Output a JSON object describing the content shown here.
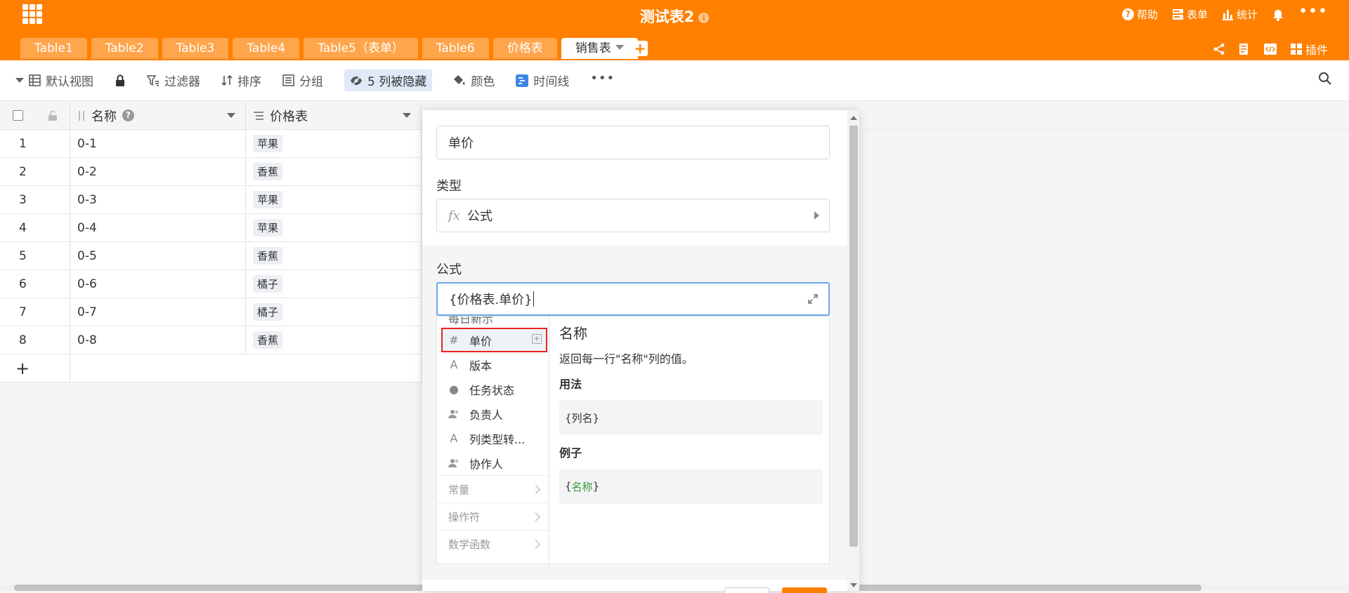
{
  "header": {
    "title": "测试表2",
    "actions": {
      "help": "帮助",
      "form": "表单",
      "stats": "统计"
    }
  },
  "tabs": [
    {
      "label": "Table1"
    },
    {
      "label": "Table2"
    },
    {
      "label": "Table3"
    },
    {
      "label": "Table4"
    },
    {
      "label": "Table5（表单）"
    },
    {
      "label": "Table6"
    },
    {
      "label": "价格表"
    },
    {
      "label": "销售表",
      "active": true
    }
  ],
  "tab_right": {
    "plugins": "插件"
  },
  "toolbar": {
    "view": "默认视图",
    "filter": "过滤器",
    "sort": "排序",
    "group": "分组",
    "hidden": "5 列被隐藏",
    "color": "颜色",
    "timeline": "时间线"
  },
  "grid": {
    "columns": [
      "名称",
      "价格表"
    ],
    "rows": [
      {
        "num": "1",
        "name": "0-1",
        "price": "苹果"
      },
      {
        "num": "2",
        "name": "0-2",
        "price": "香蕉"
      },
      {
        "num": "3",
        "name": "0-3",
        "price": "苹果"
      },
      {
        "num": "4",
        "name": "0-4",
        "price": "苹果"
      },
      {
        "num": "5",
        "name": "0-5",
        "price": "香蕉"
      },
      {
        "num": "6",
        "name": "0-6",
        "price": "橘子"
      },
      {
        "num": "7",
        "name": "0-7",
        "price": "橘子"
      },
      {
        "num": "8",
        "name": "0-8",
        "price": "香蕉"
      }
    ],
    "add_row": "+"
  },
  "panel": {
    "column_name": "单价",
    "type_label": "类型",
    "type_value": "公式",
    "formula_label": "公式",
    "formula_value": "{价格表.单价}",
    "dropdown": {
      "cut_item": "每日新示",
      "items": [
        {
          "label": "单价",
          "icon": "hash-icon",
          "selected": true
        },
        {
          "label": "版本",
          "icon": "text-icon"
        },
        {
          "label": "任务状态",
          "icon": "status-icon"
        },
        {
          "label": "负责人",
          "icon": "person-icon"
        },
        {
          "label": "列类型转...",
          "icon": "text-icon"
        },
        {
          "label": "协作人",
          "icon": "person-icon"
        }
      ],
      "categories": [
        "常量",
        "操作符",
        "数学函数"
      ],
      "detail": {
        "title": "名称",
        "description": "返回每一行\"名称\"列的值。",
        "usage_label": "用法",
        "usage": "{列名}",
        "example_label": "例子",
        "example": "{名称}"
      }
    }
  },
  "colors": {
    "accent": "#ff8000",
    "tab_inactive": "#ffa54c",
    "selection_outline": "#e22222",
    "focus": "#6aa6f0"
  }
}
